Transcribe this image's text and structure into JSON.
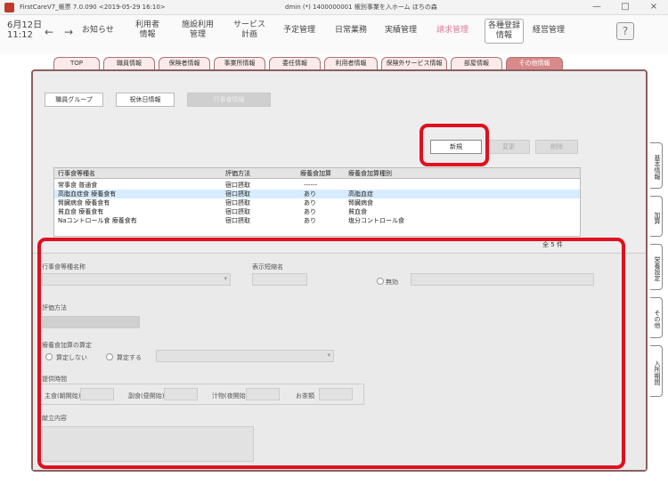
{
  "window": {
    "title": "FirstCareV7_帳票 7.0.090 <2019-05-29 16:10>",
    "doc_title": "dmin (*) 1400000001 帳別事業を入ホーム ほちの森",
    "controls": [
      "—",
      "□",
      "×"
    ]
  },
  "topnav": {
    "date_line1": "6月12日",
    "date_line2": "11:12",
    "back_arrow": "←",
    "forward_arrow": "→",
    "items": [
      {
        "label": "お知らせ"
      },
      {
        "label": "利用者\n情報"
      },
      {
        "label": "施設利用\n管理"
      },
      {
        "label": "サービス\n計画"
      },
      {
        "label": "予定管理"
      },
      {
        "label": "日常業務"
      },
      {
        "label": "実績管理"
      },
      {
        "label": "請求管理"
      },
      {
        "label": "各種登録\n情報"
      },
      {
        "label": "経営管理"
      }
    ],
    "help_icon": "?"
  },
  "tabs": [
    {
      "label": "TOP"
    },
    {
      "label": "職員情報"
    },
    {
      "label": "保険者情報"
    },
    {
      "label": "事業所情報"
    },
    {
      "label": "委任情報"
    },
    {
      "label": "利用者情報"
    },
    {
      "label": "保険外サービス情報"
    },
    {
      "label": "部屋情報"
    },
    {
      "label": "その他情報"
    }
  ],
  "subnav": {
    "btn1": "職員グループ",
    "btn2": "祝休日情報",
    "btn3": "行事食情報"
  },
  "actions": {
    "new": "新規",
    "edit": "変更",
    "delete": "削除"
  },
  "table": {
    "headers": [
      "行事食等種名",
      "評価方法",
      "療養食加算",
      "療養食加算種別"
    ],
    "rows": [
      [
        "常事食 普通食",
        "宿口摂取",
        "------",
        ""
      ],
      [
        "高脂血症食 療養食有",
        "宿口摂取",
        "あり",
        "高脂血症"
      ],
      [
        "腎臓病食 療養食有",
        "宿口摂取",
        "あり",
        "腎臓病食"
      ],
      [
        "貧血食 療養食有",
        "宿口摂取",
        "あり",
        "貧血食"
      ],
      [
        "Naコントロール食 療養食有",
        "宿口摂取",
        "あり",
        "塩分コントロール食"
      ]
    ],
    "count": "全 5 件"
  },
  "form": {
    "name_label": "行事食等種名称",
    "short_label": "表示短縮名",
    "disabled_label": "無効",
    "method_label": "評価方法",
    "addition_label": "療養食加算の算定",
    "radio_no": "算定しない",
    "radio_yes": "算定する",
    "time_label": "提供時間",
    "breakfast_label": "主食(朝開始)",
    "lunch_label": "副食(昼開始)",
    "dinner_label": "汁物(夜開始)",
    "snack_label": "お茶類",
    "content_label": "献立内容"
  },
  "side_tabs": [
    "基本情報",
    "加算",
    "栄養設定",
    "その他",
    "入所期間"
  ]
}
